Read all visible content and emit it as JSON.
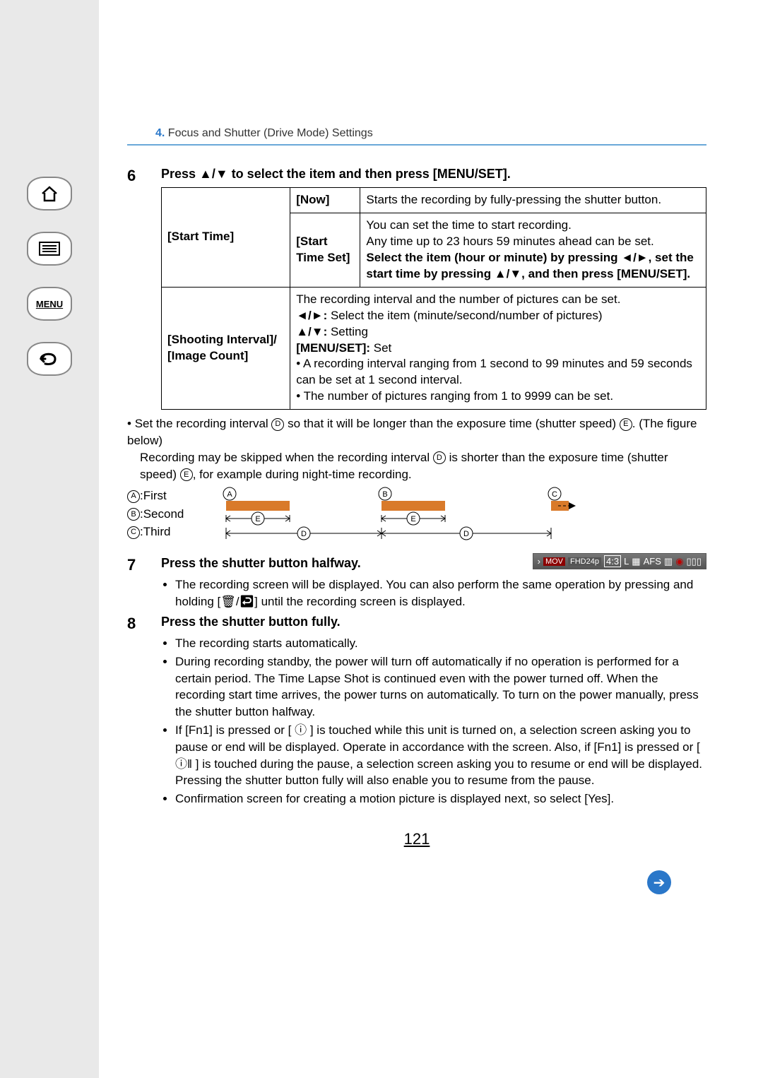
{
  "sidebar": {
    "menu_label": "MENU"
  },
  "breadcrumb": {
    "num": "4.",
    "text": "Focus and Shutter (Drive Mode) Settings"
  },
  "step6": {
    "num": "6",
    "title_pre": "Press ",
    "title_arrows": "▲/▼",
    "title_post": " to select the item and then press [MENU/SET].",
    "row1_label": "[Start Time]",
    "now_label": "[Now]",
    "now_text": "Starts the recording by fully-pressing the shutter button.",
    "stset_label": "[Start Time Set]",
    "stset_text1": "You can set the time to start recording.",
    "stset_text2": "Any time up to 23 hours 59 minutes ahead can be set.",
    "stset_bold1": "Select the item (hour or minute) by pressing ◄/►, set the start time by pressing ▲/▼, and then press [MENU/SET].",
    "row2_label": "[Shooting Interval]/ [Image Count]",
    "row2_line1": "The recording interval and the number of pictures can be set.",
    "row2_line2_pre": "◄/►: ",
    "row2_line2": "Select the item (minute/second/number of pictures)",
    "row2_line3_pre": "▲/▼: ",
    "row2_line3": "Setting",
    "row2_line4_pre": "[MENU/SET]: ",
    "row2_line4": "Set",
    "row2_bullet1": "A recording interval ranging from 1 second to 99 minutes and 59 seconds can be set at 1 second interval.",
    "row2_bullet2": "The number of pictures ranging from 1 to 9999 can be set."
  },
  "notes": {
    "n1_pre": "Set the recording interval ",
    "n1_d": "D",
    "n1_mid": " so that it will be longer than the exposure time (shutter speed) ",
    "n1_e": "E",
    "n1_post": ". (The figure below)",
    "n2_pre": "Recording may be skipped when the recording interval ",
    "n2_mid": " is shorter than the exposure time (shutter speed) ",
    "n2_post": ", for example during night-time recording."
  },
  "legend": {
    "a": "A",
    "a_txt": ":First",
    "b": "B",
    "b_txt": ":Second",
    "c": "C",
    "c_txt": ":Third"
  },
  "step7": {
    "num": "7",
    "title": "Press the shutter button halfway.",
    "status_mov": "MOV",
    "status_fhd": "FHD24p",
    "status_43": "4:3",
    "status_size": "L",
    "status_afs": "AFS",
    "bullet1": "The recording screen will be displayed. You can also perform the same operation by pressing and holding [🗑/↩] until the recording screen is displayed."
  },
  "step8": {
    "num": "8",
    "title": "Press the shutter button fully.",
    "b1": "The recording starts automatically.",
    "b2": "During recording standby, the power will turn off automatically if no operation is performed for a certain period. The Time Lapse Shot is continued even with the power turned off. When the recording start time arrives, the power turns on automatically. To turn on the power manually, press the shutter button halfway.",
    "b3": "If [Fn1] is pressed or [ ⓘ ] is touched while this unit is turned on, a selection screen asking you to pause or end will be displayed. Operate in accordance with the screen. Also, if [Fn1] is pressed or [ ⓘ‖ ] is touched during the pause, a selection screen asking you to resume or end will be displayed. Pressing the shutter button fully will also enable you to resume from the pause.",
    "b4": "Confirmation screen for creating a motion picture is displayed next, so select [Yes]."
  },
  "page": "121"
}
